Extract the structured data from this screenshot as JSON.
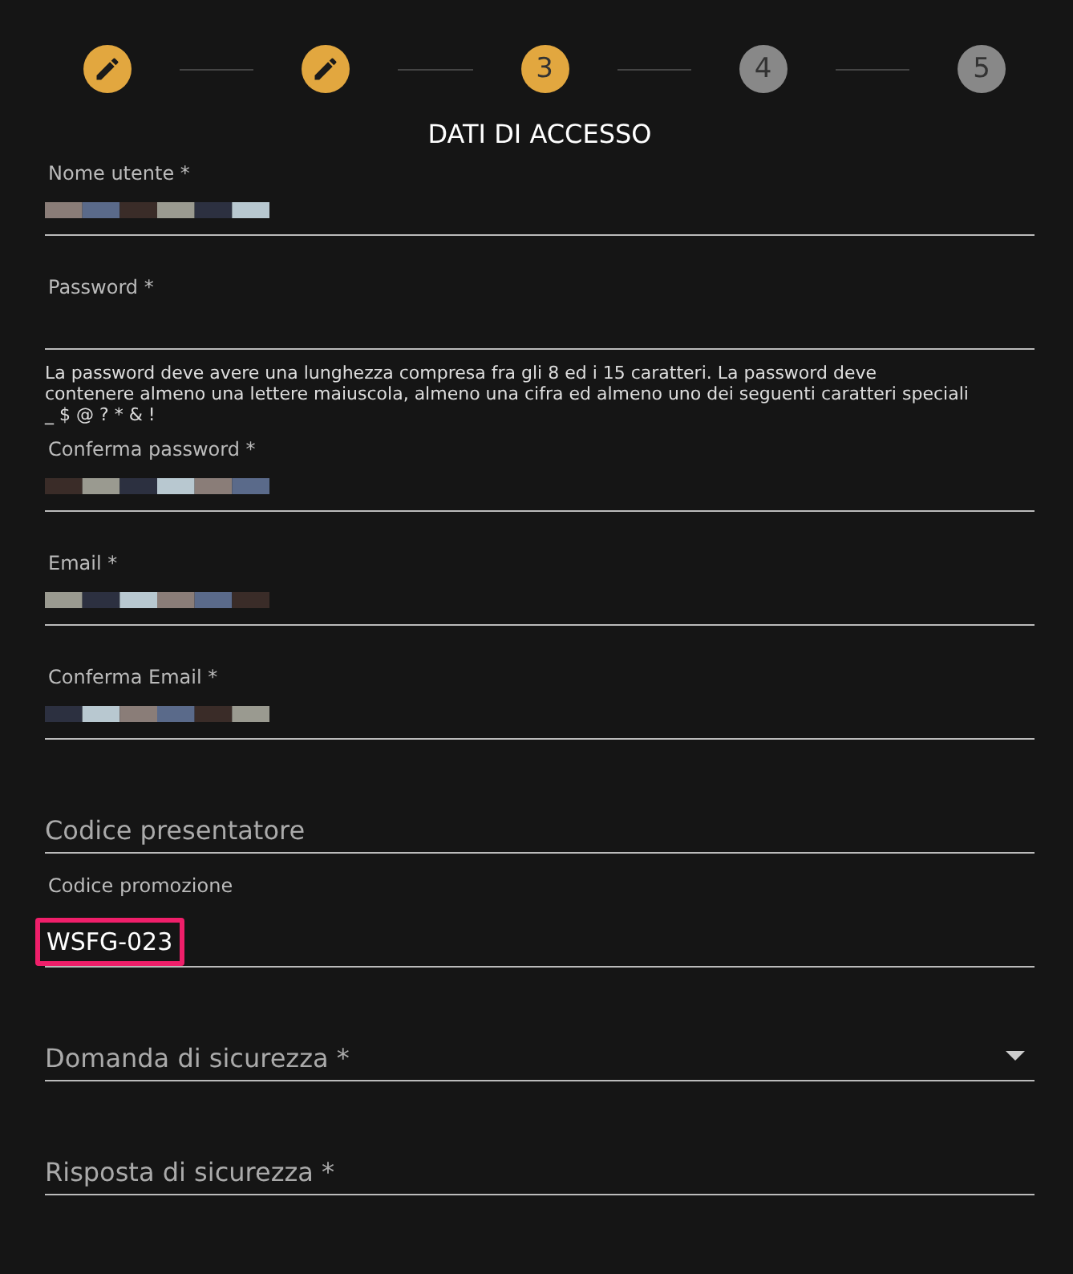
{
  "steps": [
    {
      "completed": true
    },
    {
      "completed": true
    },
    {
      "completed": false,
      "label": "3",
      "reached": true
    },
    {
      "completed": false,
      "label": "4",
      "reached": false
    },
    {
      "completed": false,
      "label": "5",
      "reached": false
    }
  ],
  "title": "DATI DI ACCESSO",
  "fields": [
    {
      "kind": "redacted",
      "label": "Nome utente *"
    },
    {
      "kind": "empty",
      "label": "Password *",
      "hint": "La password deve avere una lunghezza compresa fra gli 8 ed i 15 caratteri. La password deve contenere almeno una lettere maiuscola, almeno una cifra ed almeno uno dei seguenti caratteri speciali _ $ @ ? * & !"
    },
    {
      "kind": "redacted",
      "label": "Conferma password *"
    },
    {
      "kind": "redacted",
      "label": "Email *"
    },
    {
      "kind": "redacted",
      "label": "Conferma Email *"
    },
    {
      "kind": "placeholder",
      "label": "Codice presentatore"
    },
    {
      "kind": "value",
      "label": "Codice promozione",
      "value": "WSFG-023",
      "highlighted": true
    },
    {
      "kind": "select",
      "label": "Domanda di sicurezza *"
    },
    {
      "kind": "placeholder",
      "label": "Risposta di sicurezza *"
    }
  ]
}
